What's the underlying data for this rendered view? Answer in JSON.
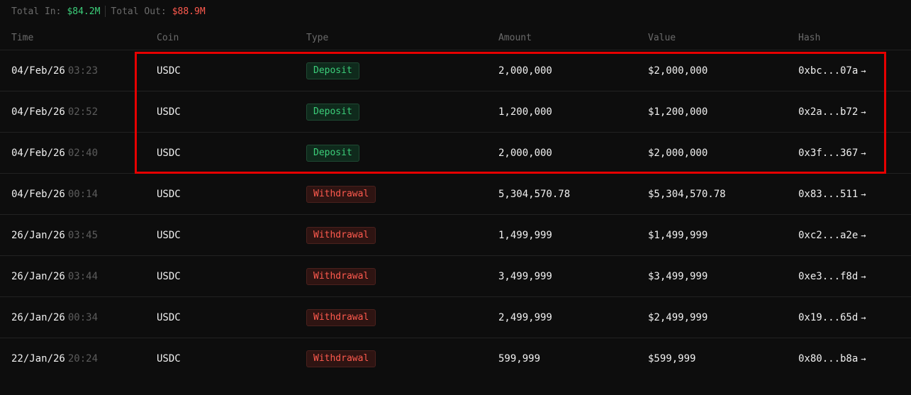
{
  "summary": {
    "total_in_label": "Total In:",
    "total_in_value": "$84.2M",
    "total_out_label": "Total Out:",
    "total_out_value": "$88.9M"
  },
  "columns": [
    "Time",
    "Coin",
    "Type",
    "Amount",
    "Value",
    "Hash"
  ],
  "rows": [
    {
      "date": "04/Feb/26",
      "clock": "03:23",
      "coin": "USDC",
      "type": "Deposit",
      "amount": "2,000,000",
      "value": "$2,000,000",
      "hash": "0xbc...07a"
    },
    {
      "date": "04/Feb/26",
      "clock": "02:52",
      "coin": "USDC",
      "type": "Deposit",
      "amount": "1,200,000",
      "value": "$1,200,000",
      "hash": "0x2a...b72"
    },
    {
      "date": "04/Feb/26",
      "clock": "02:40",
      "coin": "USDC",
      "type": "Deposit",
      "amount": "2,000,000",
      "value": "$2,000,000",
      "hash": "0x3f...367"
    },
    {
      "date": "04/Feb/26",
      "clock": "00:14",
      "coin": "USDC",
      "type": "Withdrawal",
      "amount": "5,304,570.78",
      "value": "$5,304,570.78",
      "hash": "0x83...511"
    },
    {
      "date": "26/Jan/26",
      "clock": "03:45",
      "coin": "USDC",
      "type": "Withdrawal",
      "amount": "1,499,999",
      "value": "$1,499,999",
      "hash": "0xc2...a2e"
    },
    {
      "date": "26/Jan/26",
      "clock": "03:44",
      "coin": "USDC",
      "type": "Withdrawal",
      "amount": "3,499,999",
      "value": "$3,499,999",
      "hash": "0xe3...f8d"
    },
    {
      "date": "26/Jan/26",
      "clock": "00:34",
      "coin": "USDC",
      "type": "Withdrawal",
      "amount": "2,499,999",
      "value": "$2,499,999",
      "hash": "0x19...65d"
    },
    {
      "date": "22/Jan/26",
      "clock": "20:24",
      "coin": "USDC",
      "type": "Withdrawal",
      "amount": "599,999",
      "value": "$599,999",
      "hash": "0x80...b8a"
    }
  ],
  "hash_arrow": "→",
  "colors": {
    "deposit": "#3ccf7a",
    "withdrawal": "#ff5a4e",
    "highlight": "#e60000",
    "background": "#0d0d0d"
  }
}
